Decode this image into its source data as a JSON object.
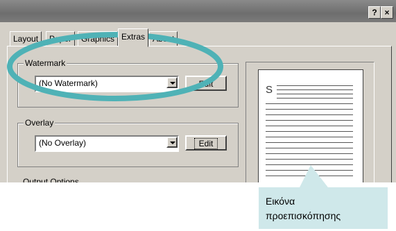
{
  "dialog": {
    "help_button": "?",
    "close_button": "×",
    "tabs": [
      {
        "label": "Layout"
      },
      {
        "label": "Paper"
      },
      {
        "label": "Graphics"
      },
      {
        "label": "Extras"
      },
      {
        "label": "About"
      }
    ],
    "watermark": {
      "legend": "Watermark",
      "selected": "(No Watermark)",
      "edit_label": "Edit"
    },
    "overlay": {
      "legend": "Overlay",
      "selected": "(No Overlay)",
      "edit_label": "Edit"
    },
    "output_options_legend": "Output Options",
    "preview_letter": "S"
  },
  "callout": {
    "line1": "Εικόνα",
    "line2": "προεπισκόπησης",
    "color": "#cfe8ea"
  },
  "highlight_color": "#4fb2b6"
}
